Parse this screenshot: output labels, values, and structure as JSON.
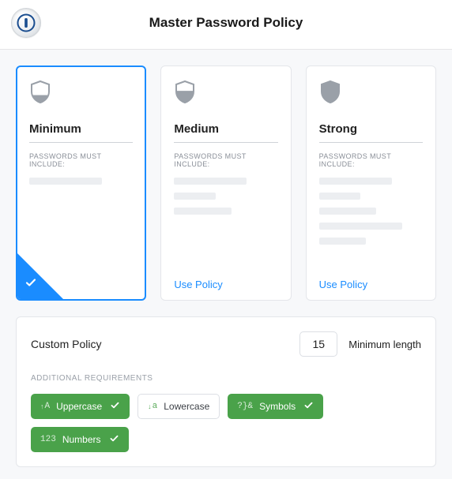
{
  "header": {
    "title": "Master Password Policy"
  },
  "policies": {
    "subtext": "PASSWORDS MUST INCLUDE:",
    "use_policy_label": "Use Policy",
    "cards": [
      {
        "name": "Minimum",
        "selected": true,
        "lines": [
          70
        ]
      },
      {
        "name": "Medium",
        "selected": false,
        "lines": [
          70,
          40,
          55
        ]
      },
      {
        "name": "Strong",
        "selected": false,
        "lines": [
          70,
          40,
          55,
          80,
          45
        ]
      }
    ]
  },
  "custom": {
    "title": "Custom Policy",
    "min_length_value": "15",
    "min_length_label": "Minimum length",
    "additional_label": "ADDITIONAL REQUIREMENTS",
    "requirements": [
      {
        "key": "uppercase",
        "label": "Uppercase",
        "enabled": true,
        "glyph": "A"
      },
      {
        "key": "lowercase",
        "label": "Lowercase",
        "enabled": false,
        "glyph": "a"
      },
      {
        "key": "symbols",
        "label": "Symbols",
        "enabled": true,
        "glyph": "?}&"
      },
      {
        "key": "numbers",
        "label": "Numbers",
        "enabled": true,
        "glyph": "123"
      }
    ]
  }
}
